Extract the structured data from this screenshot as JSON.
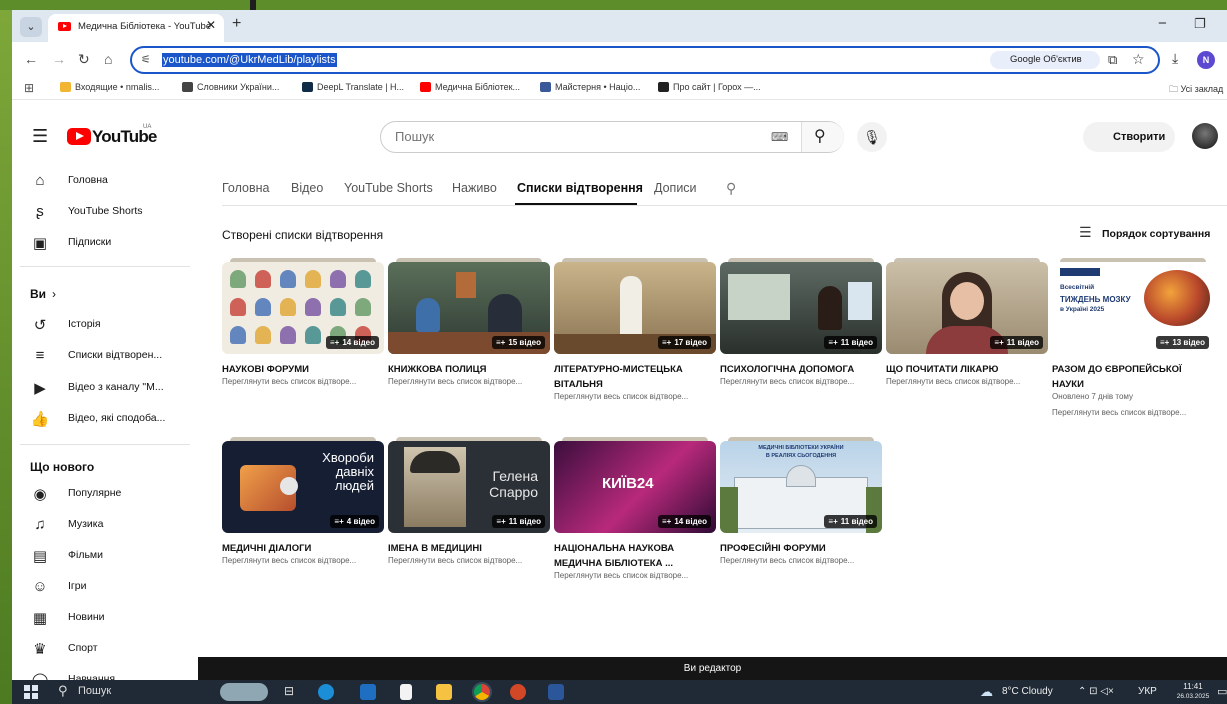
{
  "browser": {
    "tab_menu": "⌄",
    "tab_title": "Медична Бібліотека - YouTube",
    "new_tab": "+",
    "url": "youtube.com/@UkrMedLib/playlists",
    "lens_label": "Google Об'єктив",
    "profile_initial": "N",
    "bookmarks": [
      {
        "label": "Входящие • nmalis...",
        "color": "#f2b531"
      },
      {
        "label": "Словники України...",
        "color": "#444444"
      },
      {
        "label": "DeepL Translate | Н...",
        "color": "#0f2b46"
      },
      {
        "label": "Медична Бібліотек...",
        "color": "#ff0000"
      },
      {
        "label": "Майстерня • Націо...",
        "color": "#3b5998"
      },
      {
        "label": "Про сайт | Горох —...",
        "color": "#222222"
      }
    ],
    "all_bookmarks": "Усі заклад"
  },
  "youtube": {
    "wordmark": "YouTube",
    "region": "UA",
    "search_placeholder": "Пошук",
    "create_label": "Створити"
  },
  "sidebar": {
    "main": [
      {
        "label": "Головна",
        "icon": "home-icon",
        "glyph": "⌂"
      },
      {
        "label": "YouTube Shorts",
        "icon": "shorts-icon",
        "glyph": "ʂ"
      },
      {
        "label": "Підписки",
        "icon": "subscriptions-icon",
        "glyph": "▣"
      }
    ],
    "you_header": "Ви",
    "you_chevron": "›",
    "you": [
      {
        "label": "Історія",
        "icon": "history-icon",
        "glyph": "↺"
      },
      {
        "label": "Списки відтворен...",
        "icon": "playlists-icon",
        "glyph": "≡"
      },
      {
        "label": "Відео з каналу \"М...",
        "icon": "your-videos-icon",
        "glyph": "▶"
      },
      {
        "label": "Відео, які сподоба...",
        "icon": "liked-icon",
        "glyph": "👍"
      }
    ],
    "explore_header": "Що нового",
    "explore": [
      {
        "label": "Популярне",
        "icon": "trending-icon",
        "glyph": "◉"
      },
      {
        "label": "Музика",
        "icon": "music-icon",
        "glyph": "♫"
      },
      {
        "label": "Фільми",
        "icon": "movies-icon",
        "glyph": "▤"
      },
      {
        "label": "Ігри",
        "icon": "gaming-icon",
        "glyph": "☺"
      },
      {
        "label": "Новини",
        "icon": "news-icon",
        "glyph": "▦"
      },
      {
        "label": "Спорт",
        "icon": "sports-icon",
        "glyph": "♛"
      },
      {
        "label": "Навчання",
        "icon": "learning-icon",
        "glyph": "◯"
      }
    ]
  },
  "channel_tabs": [
    "Головна",
    "Відео",
    "YouTube Shorts",
    "Наживо",
    "Списки відтворення",
    "Дописи"
  ],
  "active_tab": "Списки відтворення",
  "section_title": "Створені списки відтворення",
  "sort_label": "Порядок сортування",
  "playlists": [
    {
      "title": "НАУКОВІ ФОРУМИ",
      "count": "14 відео",
      "meta": [
        "Переглянути весь список відтворе..."
      ]
    },
    {
      "title": "КНИЖКОВА ПОЛИЦЯ",
      "count": "15 відео",
      "meta": [
        "Переглянути весь список відтворе..."
      ]
    },
    {
      "title": "ЛІТЕРАТУРНО-МИСТЕЦЬКА ВІТАЛЬНЯ",
      "count": "17 відео",
      "meta": [
        "Переглянути весь список відтворе..."
      ]
    },
    {
      "title": "ПСИХОЛОГІЧНА ДОПОМОГА",
      "count": "11 відео",
      "meta": [
        "Переглянути весь список відтворе..."
      ]
    },
    {
      "title": "ЩО ПОЧИТАТИ ЛІКАРЮ",
      "count": "11 відео",
      "meta": [
        "Переглянути весь список відтворе..."
      ]
    },
    {
      "title": "РАЗОМ ДО ЄВРОПЕЙСЬКОЇ НАУКИ",
      "count": "13 відео",
      "meta": [
        "Оновлено 7 днів тому",
        "Переглянути весь список відтворе..."
      ],
      "thumb_text": [
        "Всесвітній",
        "ТИЖДЕНЬ МОЗКУ",
        "в Україні 2025"
      ]
    },
    {
      "title": "МЕДИЧНІ ДІАЛОГИ",
      "count": "4 відео",
      "meta": [
        "Переглянути весь список відтворе..."
      ],
      "thumb_text": [
        "Хвороби",
        "давніх",
        "людей"
      ]
    },
    {
      "title": "ІМЕНА В МЕДИЦИНІ",
      "count": "11 відео",
      "meta": [
        "Переглянути весь список відтворе..."
      ],
      "thumb_text": [
        "Гелена",
        "Спарро"
      ]
    },
    {
      "title": "НАЦІОНАЛЬНА НАУКОВА МЕДИЧНА БІБЛІОТЕКА ...",
      "count": "14 відео",
      "meta": [
        "Переглянути весь список відтворе..."
      ],
      "thumb_text": [
        "КИЇВ24"
      ]
    },
    {
      "title": "ПРОФЕСІЙНІ ФОРУМИ",
      "count": "11 відео",
      "meta": [
        "Переглянути весь список відтворе..."
      ],
      "thumb_text": [
        "МЕДИЧНІ БІБЛІОТЕКИ УКРАЇНИ",
        "В РЕАЛІЯХ СЬОГОДЕННЯ"
      ]
    }
  ],
  "badge_icon": "≡+",
  "editor_bar": "Ви редактор",
  "taskbar": {
    "search": "Пошук",
    "weather": "8°C Cloudy",
    "language": "УКР",
    "time": "11:41",
    "date": "26.03.2025"
  }
}
